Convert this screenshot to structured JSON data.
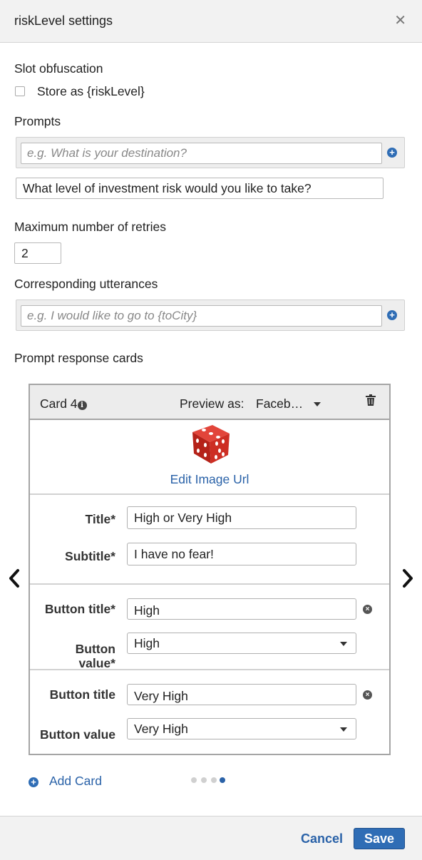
{
  "dialog": {
    "title": "riskLevel settings",
    "close_icon": "close-icon"
  },
  "slot_obfuscation": {
    "label": "Slot obfuscation",
    "checkbox_label": "Store as {riskLevel}",
    "checked": false
  },
  "prompts": {
    "label": "Prompts",
    "placeholder": "e.g. What is your destination?",
    "items": [
      "What level of investment risk would you like to take?"
    ]
  },
  "max_retries": {
    "label": "Maximum number of retries",
    "value": "2"
  },
  "utterances": {
    "label": "Corresponding utterances",
    "placeholder": "e.g. I would like to go to {toCity}"
  },
  "response_cards": {
    "label": "Prompt response cards",
    "card": {
      "name": "Card 4",
      "preview_label": "Preview as:",
      "preview_value": "Faceb…",
      "edit_image_label": "Edit Image Url",
      "title_label": "Title*",
      "title_value": "High or Very High",
      "subtitle_label": "Subtitle*",
      "subtitle_value": "I have no fear!",
      "buttons": [
        {
          "title_label": "Button title*",
          "title_value": "High",
          "value_label_line1": "Button",
          "value_label_line2": "value*",
          "value": "High"
        },
        {
          "title_label": "Button title",
          "title_value": "Very High",
          "value_label": "Button value",
          "value": "Very High"
        }
      ]
    },
    "add_card_label": "Add Card",
    "pagination": {
      "total": 4,
      "current": 4
    }
  },
  "footer": {
    "cancel_label": "Cancel",
    "save_label": "Save"
  },
  "colors": {
    "accent": "#2f6db5",
    "link": "#2a62a8",
    "header_bg": "#f2f2f2"
  }
}
